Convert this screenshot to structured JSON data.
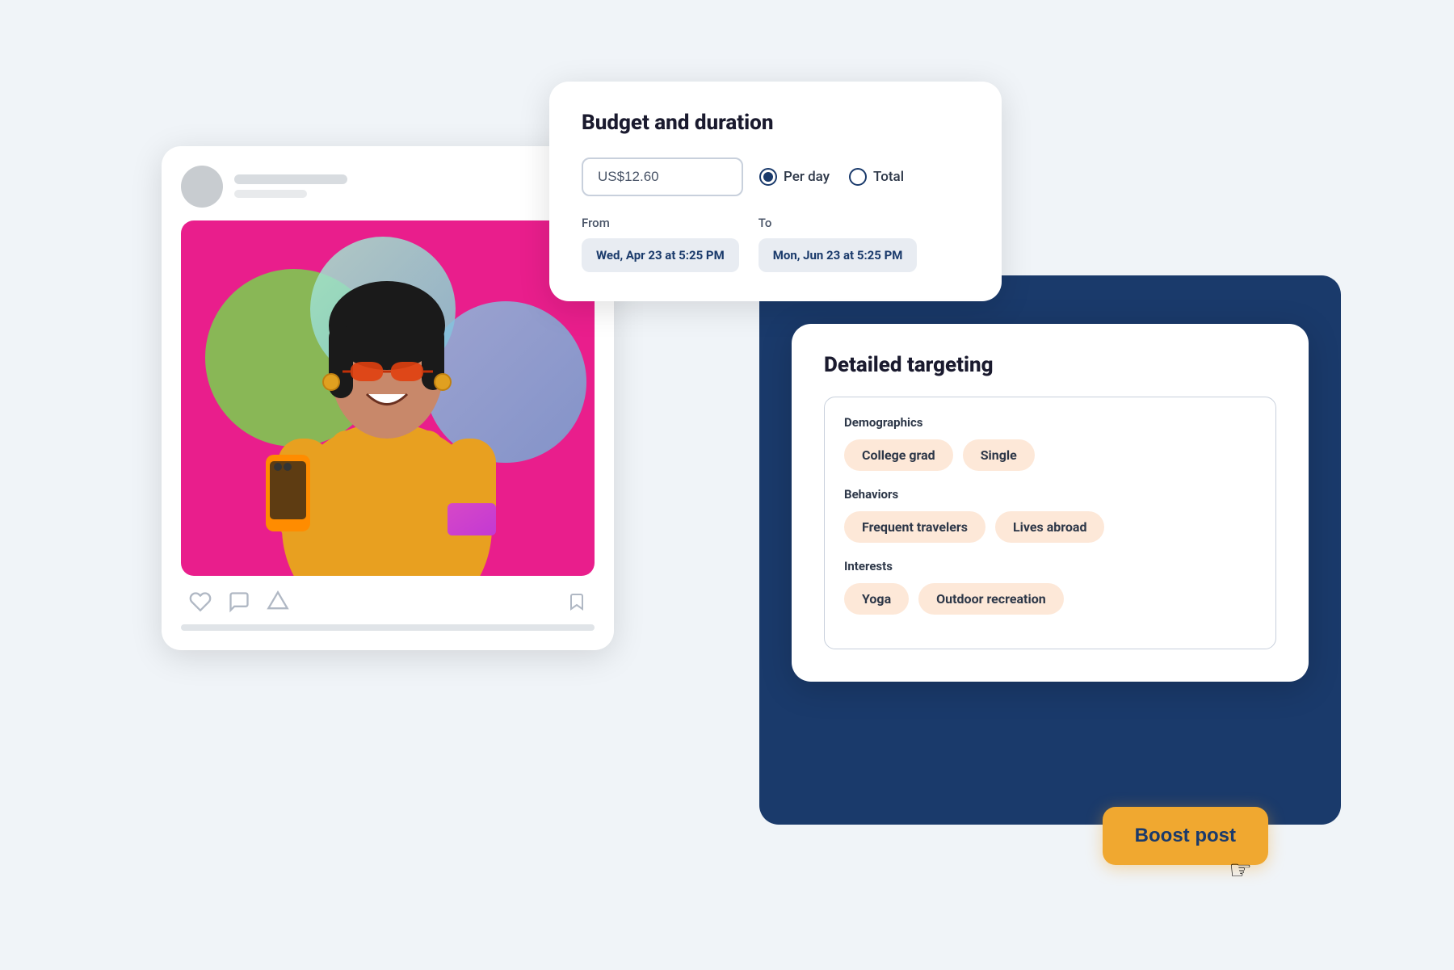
{
  "social_card": {
    "header": {
      "aria_label": "Social media post header"
    },
    "post_alt": "Woman in yellow jacket holding orange phone, smiling with sunglasses",
    "footer_icons": {
      "heart": "♡",
      "comment": "💬",
      "filter": "▽",
      "bookmark": "🔖"
    }
  },
  "budget_card": {
    "title": "Budget and duration",
    "amount": "US$12.60",
    "amount_placeholder": "US$12.60",
    "radio_options": [
      {
        "label": "Per day",
        "selected": true
      },
      {
        "label": "Total",
        "selected": false
      }
    ],
    "from_label": "From",
    "to_label": "To",
    "from_date": "Wed, Apr 23 at 5:25 PM",
    "to_date": "Mon, Jun 23 at 5:25 PM"
  },
  "targeting_card": {
    "title": "Detailed targeting",
    "sections": [
      {
        "label": "Demographics",
        "tags": [
          "College grad",
          "Single"
        ]
      },
      {
        "label": "Behaviors",
        "tags": [
          "Frequent travelers",
          "Lives abroad"
        ]
      },
      {
        "label": "Interests",
        "tags": [
          "Yoga",
          "Outdoor recreation"
        ]
      }
    ]
  },
  "boost_button": {
    "label": "Boost post"
  }
}
